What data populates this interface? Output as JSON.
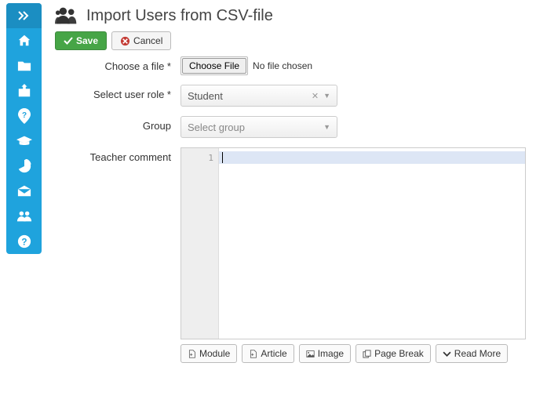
{
  "page": {
    "title": "Import Users from CSV-file"
  },
  "actions": {
    "save": "Save",
    "cancel": "Cancel"
  },
  "form": {
    "choose_file_label": "Choose a file *",
    "choose_file_button": "Choose File",
    "choose_file_status": "No file chosen",
    "role_label": "Select user role *",
    "role_value": "Student",
    "group_label": "Group",
    "group_placeholder": "Select group",
    "comment_label": "Teacher comment",
    "editor_line_number": "1"
  },
  "editor_buttons": {
    "module": "Module",
    "article": "Article",
    "image": "Image",
    "pagebreak": "Page Break",
    "readmore": "Read More"
  }
}
